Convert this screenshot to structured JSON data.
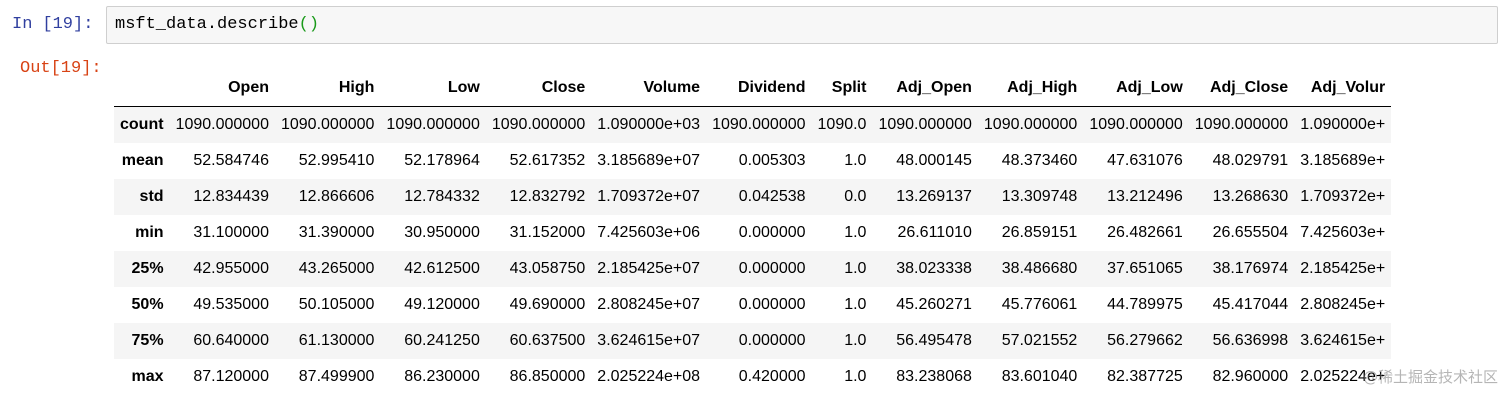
{
  "input_cell": {
    "prompt_label": "In",
    "prompt_number": "[19]:",
    "code_text": "msft_data.describe",
    "code_parens": "()"
  },
  "output_cell": {
    "prompt_label": "Out[19]:"
  },
  "table": {
    "index_header": "",
    "columns": [
      "Open",
      "High",
      "Low",
      "Close",
      "Volume",
      "Dividend",
      "Split",
      "Adj_Open",
      "Adj_High",
      "Adj_Low",
      "Adj_Close",
      "Adj_Volur"
    ],
    "rows": [
      {
        "label": "count",
        "cells": [
          "1090.000000",
          "1090.000000",
          "1090.000000",
          "1090.000000",
          "1.090000e+03",
          "1090.000000",
          "1090.0",
          "1090.000000",
          "1090.000000",
          "1090.000000",
          "1090.000000",
          "1.090000e+"
        ]
      },
      {
        "label": "mean",
        "cells": [
          "52.584746",
          "52.995410",
          "52.178964",
          "52.617352",
          "3.185689e+07",
          "0.005303",
          "1.0",
          "48.000145",
          "48.373460",
          "47.631076",
          "48.029791",
          "3.185689e+"
        ]
      },
      {
        "label": "std",
        "cells": [
          "12.834439",
          "12.866606",
          "12.784332",
          "12.832792",
          "1.709372e+07",
          "0.042538",
          "0.0",
          "13.269137",
          "13.309748",
          "13.212496",
          "13.268630",
          "1.709372e+"
        ]
      },
      {
        "label": "min",
        "cells": [
          "31.100000",
          "31.390000",
          "30.950000",
          "31.152000",
          "7.425603e+06",
          "0.000000",
          "1.0",
          "26.611010",
          "26.859151",
          "26.482661",
          "26.655504",
          "7.425603e+"
        ]
      },
      {
        "label": "25%",
        "cells": [
          "42.955000",
          "43.265000",
          "42.612500",
          "43.058750",
          "2.185425e+07",
          "0.000000",
          "1.0",
          "38.023338",
          "38.486680",
          "37.651065",
          "38.176974",
          "2.185425e+"
        ]
      },
      {
        "label": "50%",
        "cells": [
          "49.535000",
          "50.105000",
          "49.120000",
          "49.690000",
          "2.808245e+07",
          "0.000000",
          "1.0",
          "45.260271",
          "45.776061",
          "44.789975",
          "45.417044",
          "2.808245e+"
        ]
      },
      {
        "label": "75%",
        "cells": [
          "60.640000",
          "61.130000",
          "60.241250",
          "60.637500",
          "3.624615e+07",
          "0.000000",
          "1.0",
          "56.495478",
          "57.021552",
          "56.279662",
          "56.636998",
          "3.624615e+"
        ]
      },
      {
        "label": "max",
        "cells": [
          "87.120000",
          "87.499900",
          "86.230000",
          "86.850000",
          "2.025224e+08",
          "0.420000",
          "1.0",
          "83.238068",
          "83.601040",
          "82.387725",
          "82.960000",
          "2.025224e+"
        ]
      }
    ]
  },
  "watermark": {
    "text": "@稀土掘金技术社区"
  }
}
